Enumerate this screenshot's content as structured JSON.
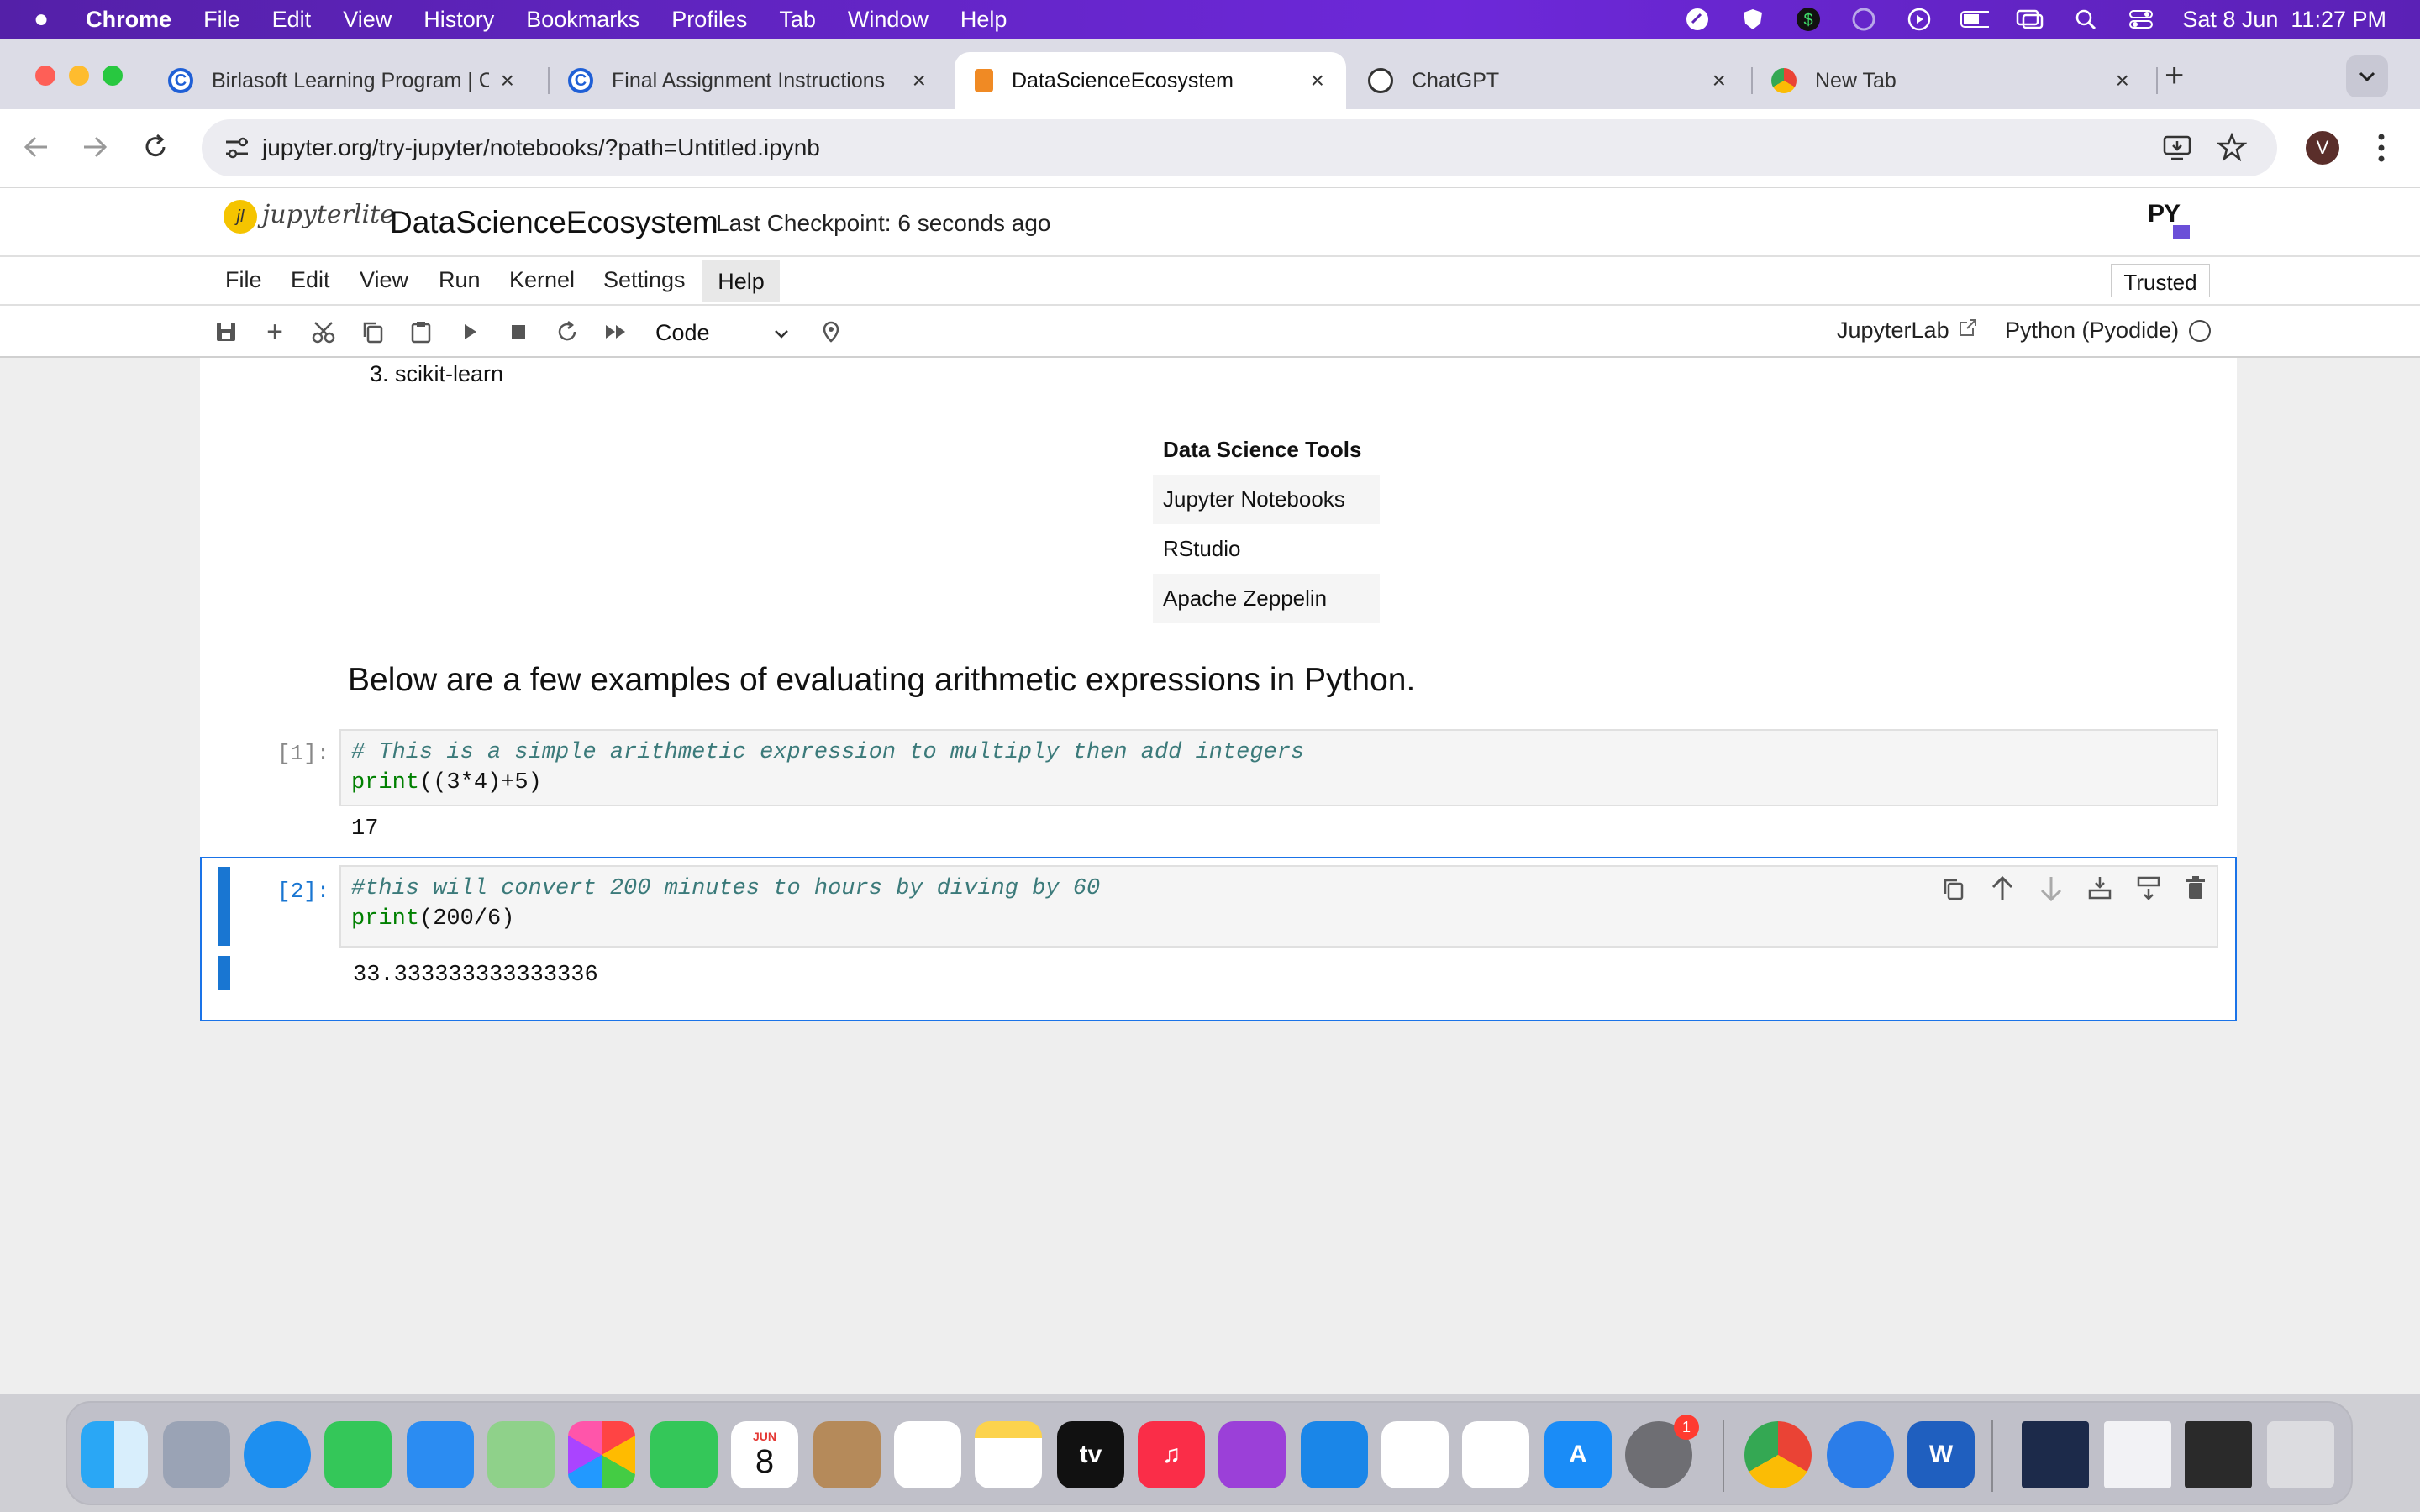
{
  "menubar": {
    "app": "Chrome",
    "items": [
      "File",
      "Edit",
      "View",
      "History",
      "Bookmarks",
      "Profiles",
      "Tab",
      "Window",
      "Help"
    ],
    "clock": "Sat 8 Jun  11:27 PM"
  },
  "tabs": [
    {
      "title": "Birlasoft Learning Program | C",
      "icon": "coursera-icon"
    },
    {
      "title": "Final Assignment Instructions",
      "icon": "coursera-icon"
    },
    {
      "title": "DataScienceEcosystem",
      "icon": "jupyter-notebook-icon"
    },
    {
      "title": "ChatGPT",
      "icon": "chatgpt-icon"
    },
    {
      "title": "New Tab",
      "icon": "chrome-icon"
    }
  ],
  "address": {
    "url": "jupyter.org/try-jupyter/notebooks/?path=Untitled.ipynb",
    "avatar": "V"
  },
  "jupyter": {
    "logo_text": "jupyterlite",
    "notebook_name": "DataScienceEcosystem",
    "checkpoint": "Last Checkpoint: 6 seconds ago",
    "menu": [
      "File",
      "Edit",
      "View",
      "Run",
      "Kernel",
      "Settings",
      "Help"
    ],
    "trusted": "Trusted",
    "cell_type": "Code",
    "jupyterlab_link": "JupyterLab",
    "kernel": "Python (Pyodide)",
    "py_badge": "PY"
  },
  "notebook": {
    "list_item": "3. scikit-learn",
    "table": {
      "header": "Data Science Tools",
      "rows": [
        "Jupyter Notebooks",
        "RStudio",
        "Apache Zeppelin"
      ]
    },
    "heading": "Below are a few examples of evaluating arithmetic expressions in Python.",
    "cell1": {
      "prompt": "[1]:",
      "comment": "# This is a simple arithmetic expression to multiply then add integers",
      "code_fn": "print",
      "code_rest": "((3*4)+5)",
      "output": "17"
    },
    "cell2": {
      "prompt": "[2]:",
      "comment": "#this will convert 200 minutes to hours by diving by 60",
      "code_fn": "print",
      "code_rest": "(200/6)",
      "output": "33.333333333333336"
    }
  },
  "dock": {
    "calendar_month": "JUN",
    "calendar_day": "8",
    "settings_badge": "1",
    "tv_label": "tv"
  }
}
